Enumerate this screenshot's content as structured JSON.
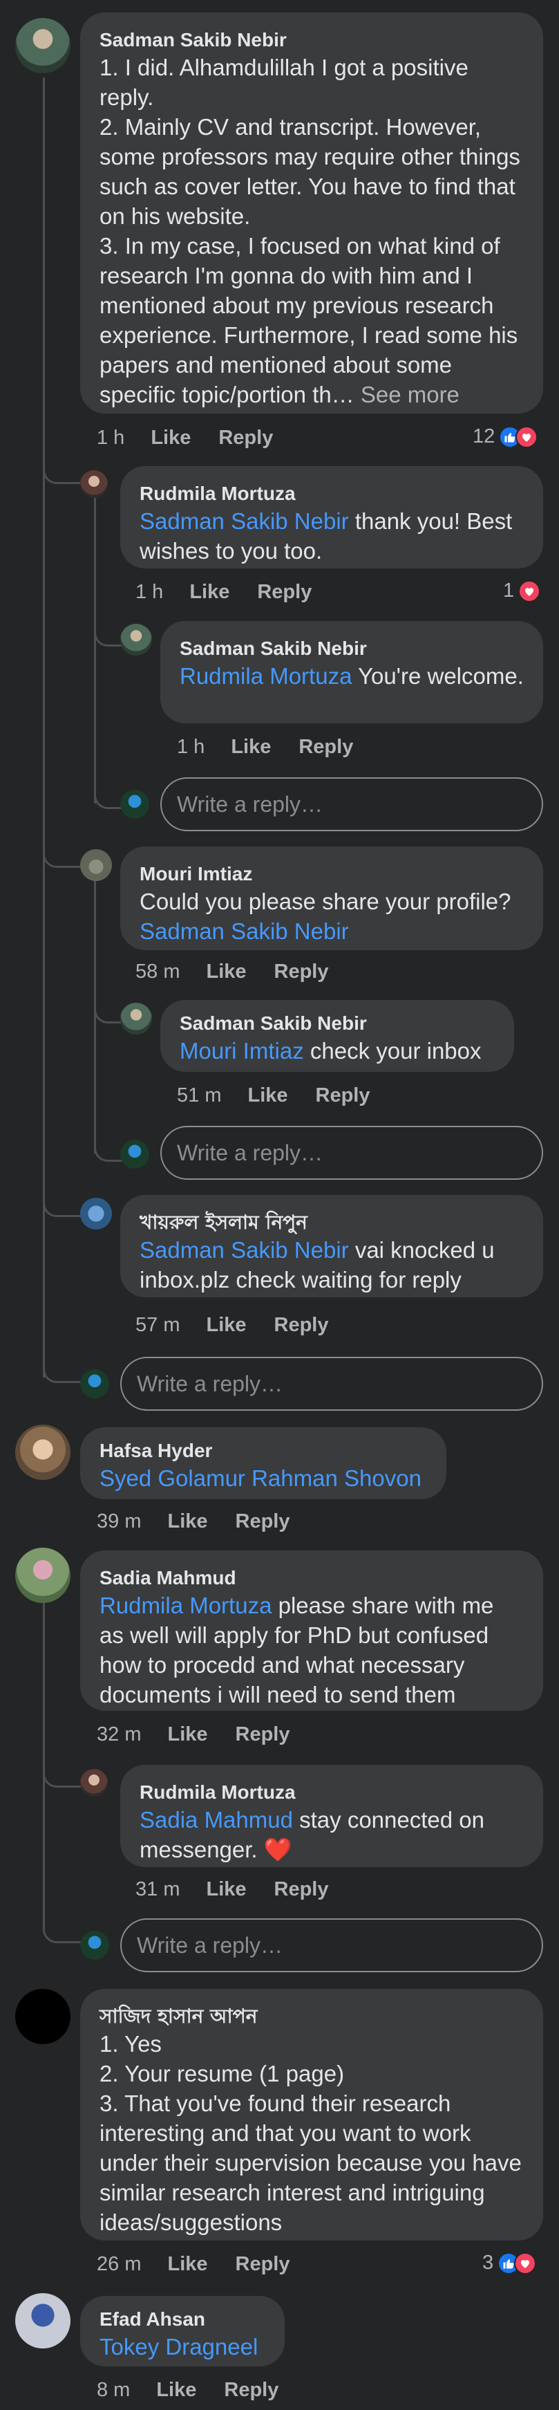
{
  "comments": {
    "c1": {
      "author": "Sadman Sakib Nebir",
      "text": "1. I did. Alhamdulillah I got a positive reply.\n2. Mainly CV and transcript. However, some professors may require other things such as cover letter. You have to find that on his website.\n3. In my case, I focused on what kind of research I'm gonna do with him and I mentioned about my previous research experience. Furthermore, I read some his papers and mentioned about some specific topic/portion th…",
      "see_more": " See more",
      "time": "1 h",
      "like": "Like",
      "reply": "Reply",
      "reactions": "12"
    },
    "r1": {
      "author": "Rudmila Mortuza",
      "mention": "Sadman Sakib Nebir",
      "text": " thank you! Best wishes to you too.",
      "time": "1 h",
      "like": "Like",
      "reply": "Reply",
      "reactions": "1"
    },
    "r2": {
      "author": "Sadman Sakib Nebir",
      "mention": "Rudmila Mortuza",
      "text": " You're welcome.",
      "time": "1 h",
      "like": "Like",
      "reply": "Reply"
    },
    "r3": {
      "author": "Mouri Imtiaz",
      "text": "Could you please share your profile?",
      "mention": "Sadman Sakib Nebir",
      "time": "58 m",
      "like": "Like",
      "reply": "Reply"
    },
    "r4": {
      "author": "Sadman Sakib Nebir",
      "mention": "Mouri Imtiaz",
      "text": " check your inbox",
      "time": "51 m",
      "like": "Like",
      "reply": "Reply"
    },
    "r5": {
      "author": "খায়রুল ইসলাম নিপুন",
      "mention": "Sadman Sakib Nebir",
      "text": " vai knocked u inbox.plz check waiting for reply",
      "time": "57 m",
      "like": "Like",
      "reply": "Reply"
    },
    "c2": {
      "author": "Hafsa Hyder",
      "mention": "Syed Golamur Rahman Shovon",
      "time": "39 m",
      "like": "Like",
      "reply": "Reply"
    },
    "c3": {
      "author": "Sadia Mahmud",
      "mention": "Rudmila Mortuza",
      "text": "  please share with me as well will apply for PhD but confused how to procedd and what necessary documents i will need to send them",
      "time": "32 m",
      "like": "Like",
      "reply": "Reply"
    },
    "r6": {
      "author": "Rudmila Mortuza",
      "mention": "Sadia Mahmud",
      "text": " stay connected on messenger. ",
      "emoji": "❤️",
      "time": "31 m",
      "like": "Like",
      "reply": "Reply"
    },
    "c4": {
      "author": "সাজিদ হাসান আপন",
      "text": "1. Yes\n2. Your resume (1 page)\n3. That you've found their research interesting and that you want to work under their supervision because you have similar research interest and intriguing ideas/suggestions",
      "time": "26 m",
      "like": "Like",
      "reply": "Reply",
      "reactions": "3"
    },
    "c5": {
      "author": "Efad Ahsan",
      "mention": "Tokey Dragneel",
      "time": "8 m",
      "like": "Like",
      "reply": "Reply"
    }
  },
  "reply_placeholder": "Write a reply…",
  "colors": {
    "accent": "#4599ff",
    "like": "#1877f2",
    "love": "#f3425f",
    "bubble": "#3a3b3c"
  }
}
